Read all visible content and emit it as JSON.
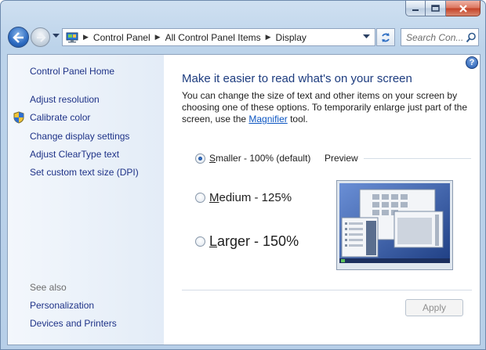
{
  "address": {
    "breadcrumbs": [
      "Control Panel",
      "All Control Panel Items",
      "Display"
    ]
  },
  "search": {
    "placeholder": "Search Con..."
  },
  "sidebar": {
    "home": "Control Panel Home",
    "links": [
      "Adjust resolution",
      "Calibrate color",
      "Change display settings",
      "Adjust ClearType text",
      "Set custom text size (DPI)"
    ],
    "see_also_heading": "See also",
    "see_also": [
      "Personalization",
      "Devices and Printers"
    ]
  },
  "main": {
    "heading": "Make it easier to read what's on your screen",
    "desc_before": "You can change the size of text and other items on your screen by choosing one of these options. To temporarily enlarge just part of the screen, use the ",
    "desc_link": "Magnifier",
    "desc_after": " tool.",
    "options": [
      {
        "key": "S",
        "rest": "maller - 100% (default)",
        "selected": true
      },
      {
        "key": "M",
        "rest": "edium - 125%",
        "selected": false
      },
      {
        "key": "L",
        "rest": "arger - 150%",
        "selected": false
      }
    ],
    "preview_label": "Preview",
    "apply_label": "Apply",
    "apply_enabled": false
  },
  "colors": {
    "accent": "#1d3c7f",
    "link": "#1e3287",
    "hyperlink": "#0b55c2"
  },
  "icons": {
    "back": "back-arrow-icon",
    "forward": "forward-arrow-icon",
    "address": "control-panel-icon",
    "refresh": "refresh-icon",
    "search": "search-icon",
    "help": "help-icon",
    "shield": "uac-shield-icon"
  }
}
